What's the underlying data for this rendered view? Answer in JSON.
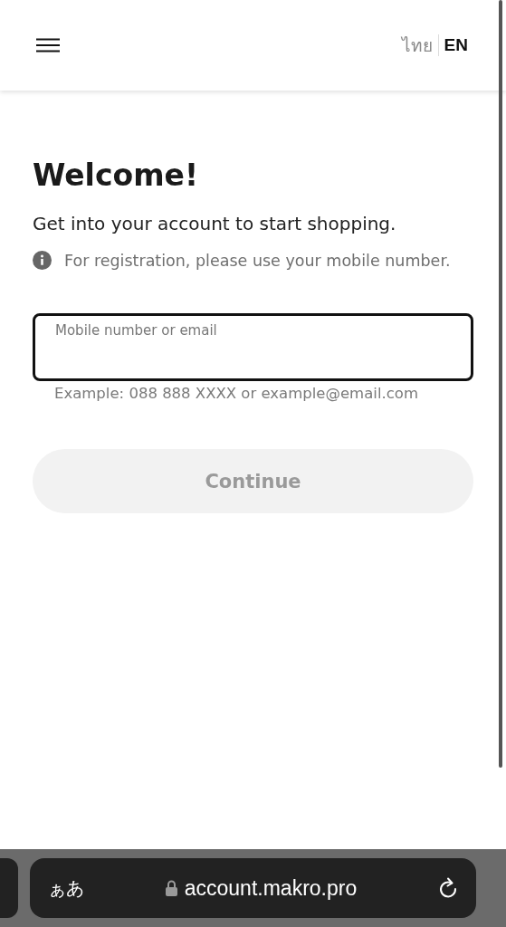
{
  "header": {
    "languages": [
      {
        "label": "ไทย",
        "selected": false
      },
      {
        "label": "EN",
        "selected": true
      }
    ]
  },
  "title": "Welcome!",
  "subtitle": "Get into your account to start shopping.",
  "notice": "For registration, please use your mobile number.",
  "login_field": {
    "label": "Mobile number or email",
    "helper": "Example: 088 888 XXXX or example@email.com"
  },
  "continue_button": {
    "label": "Continue",
    "disabled": true
  },
  "browser_bar": {
    "text_size": "ぁあ",
    "url": "account.makro.pro"
  }
}
